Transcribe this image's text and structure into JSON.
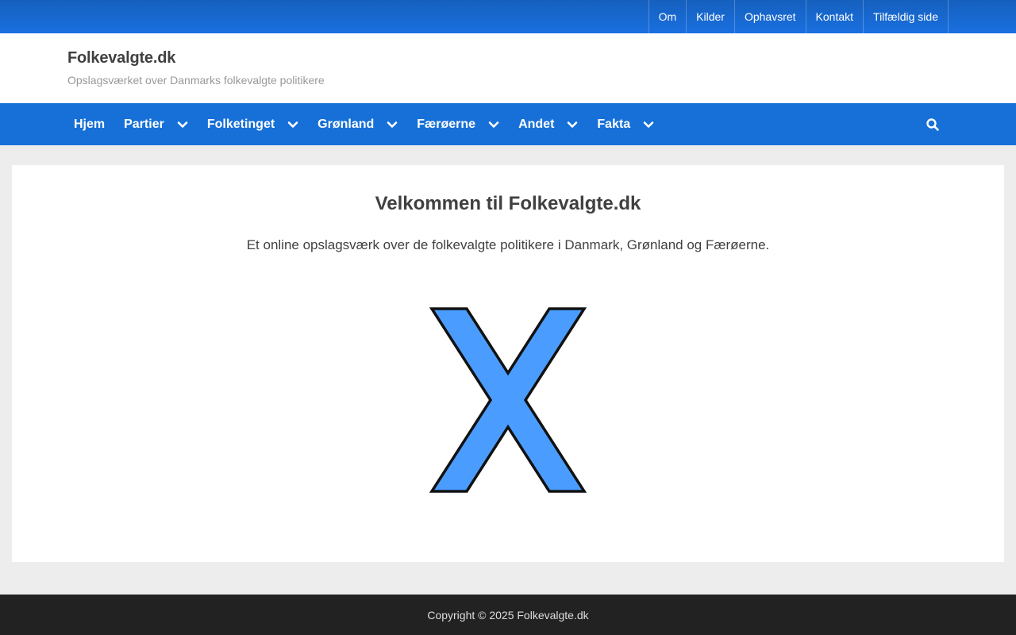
{
  "top_menu": [
    "Om",
    "Kilder",
    "Ophavsret",
    "Kontakt",
    "Tilfældig side"
  ],
  "site": {
    "title": "Folkevalgte.dk",
    "description": "Opslagsværket over Danmarks folkevalgte politikere"
  },
  "nav": {
    "items": [
      {
        "label": "Hjem",
        "has_dropdown": false
      },
      {
        "label": "Partier",
        "has_dropdown": true
      },
      {
        "label": "Folketinget",
        "has_dropdown": true
      },
      {
        "label": "Grønland",
        "has_dropdown": true
      },
      {
        "label": "Færøerne",
        "has_dropdown": true
      },
      {
        "label": "Andet",
        "has_dropdown": true
      },
      {
        "label": "Fakta",
        "has_dropdown": true
      }
    ],
    "search_icon": "search-icon"
  },
  "main": {
    "heading": "Velkommen til Folkevalgte.dk",
    "intro": "Et online opslagsværk over de folkevalgte politikere i Danmark, Grønland og Færøerne."
  },
  "footer": {
    "copyright": "Copyright © 2025 Folkevalgte.dk"
  },
  "colors": {
    "topbar": "#1a6fe0",
    "nav": "#1670d8",
    "logo_fill": "#4a9dff",
    "footer": "#222222",
    "page_bg": "#ededed"
  }
}
